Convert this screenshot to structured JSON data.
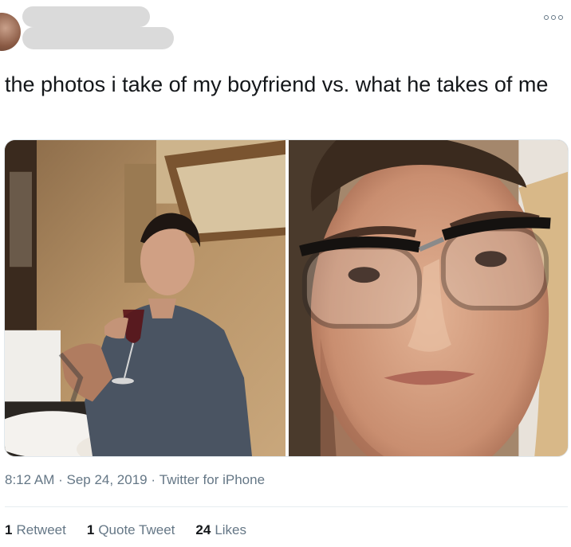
{
  "tweet": {
    "text": "the photos i take of my boyfriend vs. what he takes of me",
    "time": "8:12 AM",
    "date": "Sep 24, 2019",
    "source": "Twitter for iPhone",
    "separator": " · "
  },
  "stats": {
    "retweets_count": "1",
    "retweets_label": "Retweet",
    "quotes_count": "1",
    "quotes_label": "Quote Tweet",
    "likes_count": "24",
    "likes_label": "Likes"
  },
  "icons": {
    "more": "more-options-icon"
  },
  "colors": {
    "text": "#14171a",
    "secondary": "#657786",
    "redaction": "#dadada"
  }
}
